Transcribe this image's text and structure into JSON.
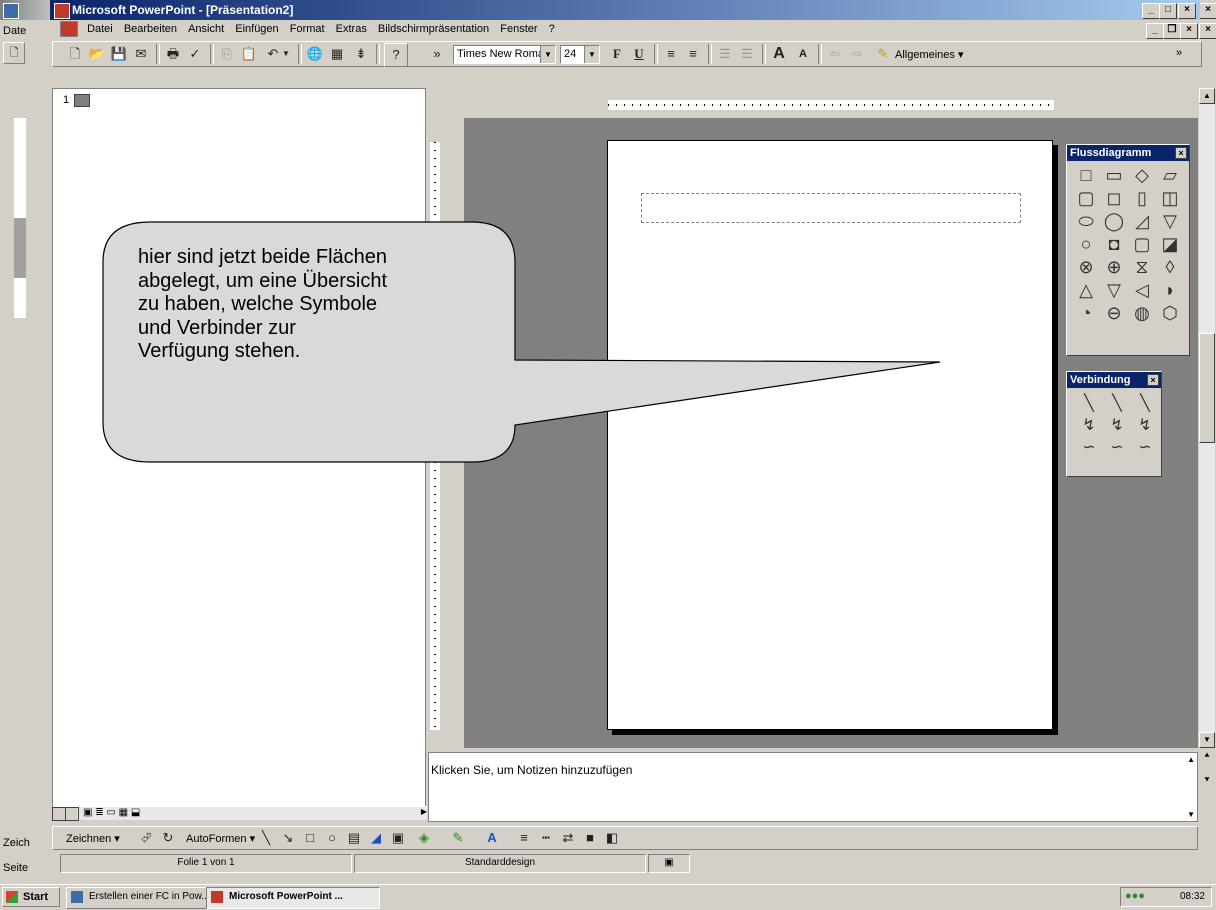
{
  "outer_window": {
    "menu_fragment": "Date",
    "toolbar_fragment": "Zeich",
    "status_fragment": "Seite"
  },
  "app": {
    "title": "Microsoft PowerPoint - [Präsentation2]",
    "menu": [
      "Datei",
      "Bearbeiten",
      "Ansicht",
      "Einfügen",
      "Format",
      "Extras",
      "Bildschirmpräsentation",
      "Fenster",
      "?"
    ],
    "font_name": "Times New Roman",
    "font_size": "24",
    "bold_label": "F",
    "underline_label": "U",
    "tasks_label": "Allgemeines ▾",
    "overflow": "»"
  },
  "outline": {
    "slide_number": "1"
  },
  "notes": {
    "placeholder": "Klicken Sie, um Notizen hinzuzufügen"
  },
  "drawing_toolbar": {
    "draw_menu": "Zeichnen ▾",
    "autoshapes_menu": "AutoFormen ▾"
  },
  "status_bar": {
    "slide_info": "Folie 1 von 1",
    "design": "Standarddesign"
  },
  "flow_palette": {
    "title": "Flussdiagramm",
    "close": "×",
    "shapes": [
      "□",
      "▭",
      "◇",
      "▱",
      "▢",
      "◻",
      "▯",
      "◫",
      "⬭",
      "◯",
      "◿",
      "▽",
      "○",
      "◘",
      "▢",
      "◪",
      "⊗",
      "⊕",
      "⧖",
      "◊",
      "△",
      "▽",
      "◁",
      "◗",
      "◔",
      "⊖",
      "◍",
      "⬡"
    ]
  },
  "connector_palette": {
    "title": "Verbindung",
    "close": "×",
    "items": [
      "╲",
      "╲",
      "╲",
      "↯",
      "↯",
      "↯",
      "∽",
      "∽",
      "∽"
    ]
  },
  "callout": {
    "text": "hier sind jetzt beide Flächen\nabgelegt, um eine Übersicht\nzu haben, welche Symbole\nund Verbinder zur\nVerfügung stehen."
  },
  "taskbar": {
    "start": "Start",
    "tasks": [
      "Erstellen einer FC in Pow...",
      "Microsoft PowerPoint ..."
    ],
    "clock": "08:32"
  },
  "colors": {
    "titlebar": "#0a246a",
    "workspace": "#808080",
    "face": "#d4d0c8",
    "callout_fill": "#d9d9d9"
  }
}
